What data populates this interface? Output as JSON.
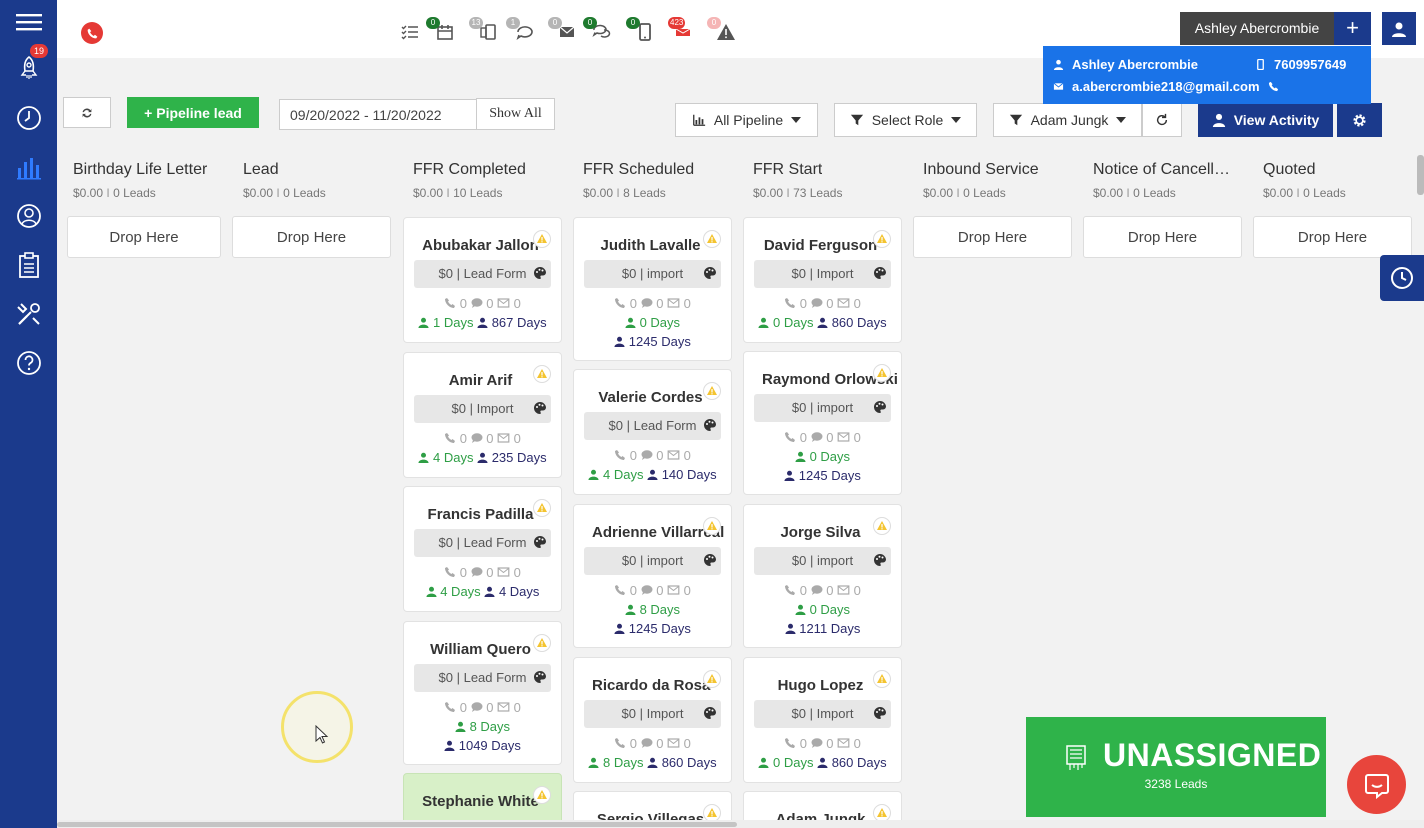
{
  "sidebar": {
    "notification_count": "19",
    "items": [
      "menu",
      "launch",
      "timer",
      "pipeline",
      "contacts",
      "tasks",
      "tools",
      "help"
    ]
  },
  "topbar": {
    "counts": {
      "tasks": "",
      "calendar": "0",
      "mobile": "13",
      "chat": "1",
      "email": "0",
      "conversations": "0",
      "sms": "0",
      "notifications": "423",
      "alerts": "0"
    },
    "user_name": "Ashley Abercrombie",
    "add_label": "+"
  },
  "user_popup": {
    "name": "Ashley Abercrombie",
    "phone": "7609957649",
    "email": "a.abercrombie218@gmail.com"
  },
  "toolbar": {
    "add_lead_label": "+ Pipeline lead",
    "date_range": "09/20/2022 - 11/20/2022",
    "show_all_label": "Show All",
    "pipeline_filter": "All Pipeline",
    "role_filter": "Select Role",
    "user_filter": "Adam Jungk",
    "view_activity_label": "View Activity"
  },
  "columns": [
    {
      "title": "Birthday Life Letter",
      "amount": "$0.00",
      "leads": "0 Leads",
      "drop": "Drop Here"
    },
    {
      "title": "Lead",
      "amount": "$0.00",
      "leads": "0 Leads",
      "drop": "Drop Here"
    },
    {
      "title": "FFR Completed",
      "amount": "$0.00",
      "leads": "10 Leads",
      "drop": ""
    },
    {
      "title": "FFR Scheduled",
      "amount": "$0.00",
      "leads": "8 Leads",
      "drop": ""
    },
    {
      "title": "FFR Start",
      "amount": "$0.00",
      "leads": "73 Leads",
      "drop": ""
    },
    {
      "title": "Inbound Service",
      "amount": "$0.00",
      "leads": "0 Leads",
      "drop": "Drop Here"
    },
    {
      "title": "Notice of Cancell…",
      "amount": "$0.00",
      "leads": "0 Leads",
      "drop": "Drop Here"
    },
    {
      "title": "Quoted",
      "amount": "$0.00",
      "leads": "0 Leads",
      "drop": "Drop Here"
    }
  ],
  "cards": {
    "ffr_completed": [
      {
        "name": "Abubakar Jallon",
        "source": "$0 | Lead Form",
        "calls": "0",
        "msgs": "0",
        "mails": "0",
        "d1": "1 Days",
        "d2": "867 Days"
      },
      {
        "name": "Amir Arif",
        "source": "$0 | Import",
        "calls": "0",
        "msgs": "0",
        "mails": "0",
        "d1": "4 Days",
        "d2": "235 Days"
      },
      {
        "name": "Francis Padilla",
        "source": "$0 | Lead Form",
        "calls": "0",
        "msgs": "0",
        "mails": "0",
        "d1": "4 Days",
        "d2": "4 Days"
      },
      {
        "name": "William Quero",
        "source": "$0 | Lead Form",
        "calls": "0",
        "msgs": "0",
        "mails": "0",
        "d1": "8 Days",
        "d2": "1049 Days"
      },
      {
        "name": "Stephanie White",
        "source": "",
        "calls": "",
        "msgs": "",
        "mails": "",
        "d1": "",
        "d2": ""
      }
    ],
    "ffr_scheduled": [
      {
        "name": "Judith Lavalle",
        "source": "$0 | import",
        "calls": "0",
        "msgs": "0",
        "mails": "0",
        "d1": "0 Days",
        "d2": "1245 Days"
      },
      {
        "name": "Valerie Cordes",
        "source": "$0 | Lead Form",
        "calls": "0",
        "msgs": "0",
        "mails": "0",
        "d1": "4 Days",
        "d2": "140 Days"
      },
      {
        "name": "Adrienne Villarreal",
        "source": "$0 | import",
        "calls": "0",
        "msgs": "0",
        "mails": "0",
        "d1": "8 Days",
        "d2": "1245 Days"
      },
      {
        "name": "Ricardo da Rosa",
        "source": "$0 | Import",
        "calls": "0",
        "msgs": "0",
        "mails": "0",
        "d1": "8 Days",
        "d2": "860 Days"
      },
      {
        "name": "Sergio Villegas",
        "source": "",
        "calls": "",
        "msgs": "",
        "mails": "",
        "d1": "",
        "d2": ""
      }
    ],
    "ffr_start": [
      {
        "name": "David Ferguson",
        "source": "$0 | Import",
        "calls": "0",
        "msgs": "0",
        "mails": "0",
        "d1": "0 Days",
        "d2": "860 Days"
      },
      {
        "name": "Raymond Orlowski",
        "source": "$0 | import",
        "calls": "0",
        "msgs": "0",
        "mails": "0",
        "d1": "0 Days",
        "d2": "1245 Days"
      },
      {
        "name": "Jorge Silva",
        "source": "$0 | import",
        "calls": "0",
        "msgs": "0",
        "mails": "0",
        "d1": "0 Days",
        "d2": "1211 Days"
      },
      {
        "name": "Hugo Lopez",
        "source": "$0 | Import",
        "calls": "0",
        "msgs": "0",
        "mails": "0",
        "d1": "0 Days",
        "d2": "860 Days"
      },
      {
        "name": "Adam Jungk",
        "source": "",
        "calls": "",
        "msgs": "",
        "mails": "",
        "d1": "",
        "d2": ""
      }
    ]
  },
  "unassigned": {
    "title": "UNASSIGNED",
    "count": "3238 Leads"
  },
  "colors": {
    "sidebar": "#1b3a8c",
    "accent_green": "#2fb34a",
    "popup_blue": "#1a73e8",
    "days_green": "#2e9e45",
    "days_navy": "#2b2b6b"
  }
}
